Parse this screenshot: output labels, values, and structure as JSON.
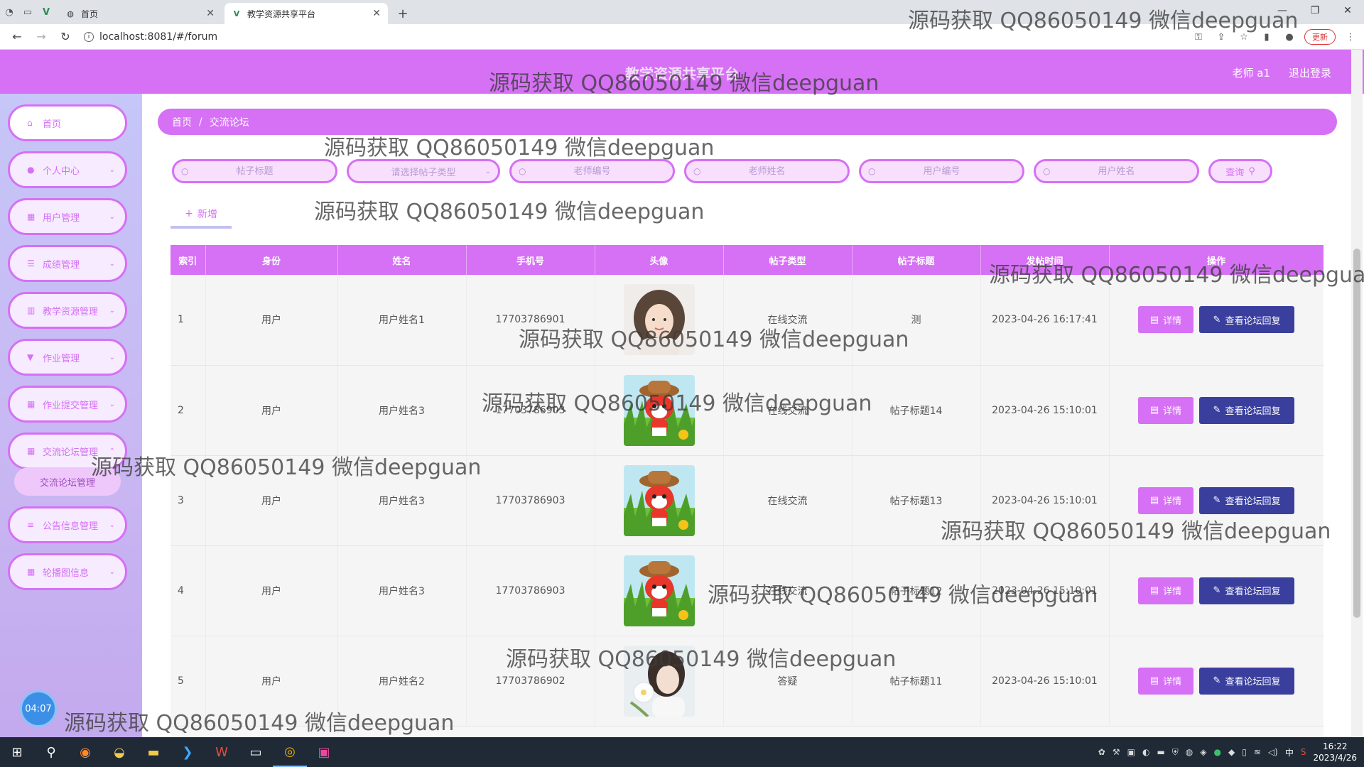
{
  "browser": {
    "tabs": [
      {
        "title": "首页",
        "icon": "globe-icon"
      },
      {
        "title": "教学资源共享平台",
        "icon": "vue-icon"
      }
    ],
    "url": "localhost:8081/#/forum",
    "update_label": "更新"
  },
  "header": {
    "title": "教学资源共享平台",
    "user": "老师 a1",
    "logout": "退出登录"
  },
  "sidebar": {
    "items": [
      {
        "label": "首页",
        "icon": "home-icon"
      },
      {
        "label": "个人中心",
        "icon": "user-icon"
      },
      {
        "label": "用户管理",
        "icon": "grid-icon"
      },
      {
        "label": "成绩管理",
        "icon": "sliders-icon"
      },
      {
        "label": "教学资源管理",
        "icon": "chart-icon"
      },
      {
        "label": "作业管理",
        "icon": "pin-icon"
      },
      {
        "label": "作业提交管理",
        "icon": "grid-icon"
      },
      {
        "label": "交流论坛管理",
        "icon": "grid-icon"
      },
      {
        "label": "公告信息管理",
        "icon": "list-icon"
      },
      {
        "label": "轮播图信息",
        "icon": "grid-icon"
      }
    ],
    "submenu": {
      "label": "交流论坛管理"
    },
    "clock_badge": "04:07"
  },
  "breadcrumb": {
    "home": "首页",
    "sep": "/",
    "current": "交流论坛"
  },
  "search": {
    "post_title_placeholder": "帖子标题",
    "post_type_placeholder": "请选择帖子类型",
    "teacher_no_placeholder": "老师编号",
    "teacher_name_placeholder": "老师姓名",
    "user_no_placeholder": "用户编号",
    "user_name_placeholder": "用户姓名",
    "query_label": "查询"
  },
  "toolbar": {
    "add_label": "新增"
  },
  "table": {
    "columns": [
      "索引",
      "身份",
      "姓名",
      "手机号",
      "头像",
      "帖子类型",
      "帖子标题",
      "发帖时间",
      "操作"
    ],
    "detail_label": "详情",
    "reply_label": "查看论坛回复",
    "rows": [
      {
        "index": "1",
        "role": "用户",
        "name": "用户姓名1",
        "phone": "17703786901",
        "avatar": "woman",
        "type": "在线交流",
        "title": "测",
        "time": "2023-04-26 16:17:41"
      },
      {
        "index": "2",
        "role": "用户",
        "name": "用户姓名3",
        "phone": "17703786903",
        "avatar": "cartoon",
        "type": "在线交流",
        "title": "帖子标题14",
        "time": "2023-04-26 15:10:01"
      },
      {
        "index": "3",
        "role": "用户",
        "name": "用户姓名3",
        "phone": "17703786903",
        "avatar": "cartoon",
        "type": "在线交流",
        "title": "帖子标题13",
        "time": "2023-04-26 15:10:01"
      },
      {
        "index": "4",
        "role": "用户",
        "name": "用户姓名3",
        "phone": "17703786903",
        "avatar": "cartoon",
        "type": "在线交流",
        "title": "帖子标题12",
        "time": "2023-04-26 15:10:01"
      },
      {
        "index": "5",
        "role": "用户",
        "name": "用户姓名2",
        "phone": "17703786902",
        "avatar": "flower",
        "type": "答疑",
        "title": "帖子标题11",
        "time": "2023-04-26 15:10:01"
      }
    ]
  },
  "watermark": {
    "text": "源码获取 QQ86050149 微信deepguan"
  },
  "taskbar": {
    "time": "16:22",
    "date": "2023/4/26",
    "ime": "中"
  },
  "colors": {
    "accent": "#d670f5",
    "reply_button": "#3a3f9e",
    "sidebar_bg": "#c6c6f8"
  }
}
